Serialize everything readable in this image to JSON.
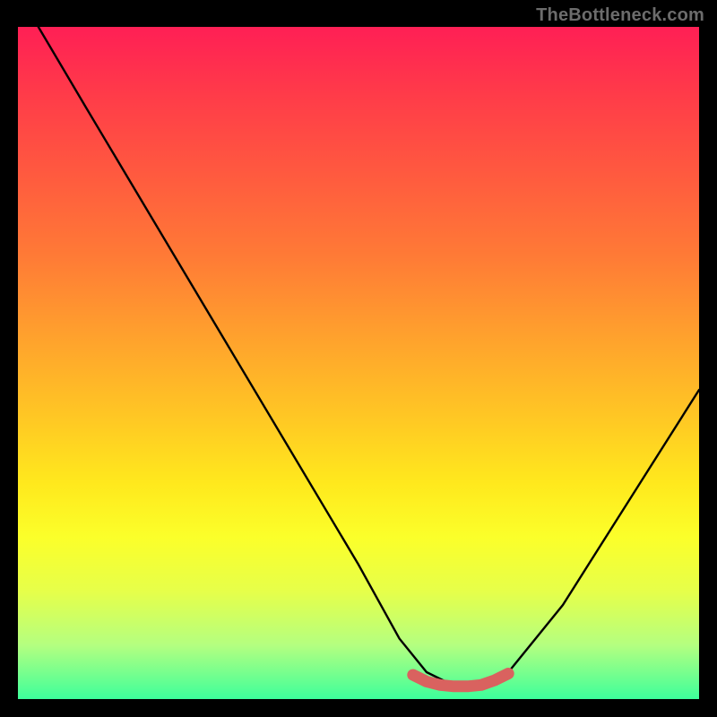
{
  "watermark": "TheBottleneck.com",
  "chart_data": {
    "type": "line",
    "title": "",
    "xlabel": "",
    "ylabel": "",
    "x_range": [
      0,
      100
    ],
    "y_range": [
      0,
      100
    ],
    "series": [
      {
        "name": "curve",
        "x": [
          3,
          10,
          20,
          30,
          40,
          50,
          56,
          60,
          64,
          68,
          72,
          80,
          90,
          100
        ],
        "values": [
          100,
          88,
          71,
          54,
          37,
          20,
          9,
          4,
          2,
          2,
          4,
          14,
          30,
          46
        ]
      },
      {
        "name": "optimum-marker",
        "x": [
          58,
          60,
          62,
          64,
          66,
          68,
          70,
          72
        ],
        "values": [
          3.6,
          2.6,
          2.1,
          1.9,
          1.9,
          2.1,
          2.8,
          3.8
        ]
      }
    ],
    "colors": {
      "curve": "#000000",
      "optimum_marker": "#d9625f",
      "gradient_top": "#ff1f55",
      "gradient_bottom": "#3dff9b"
    }
  }
}
